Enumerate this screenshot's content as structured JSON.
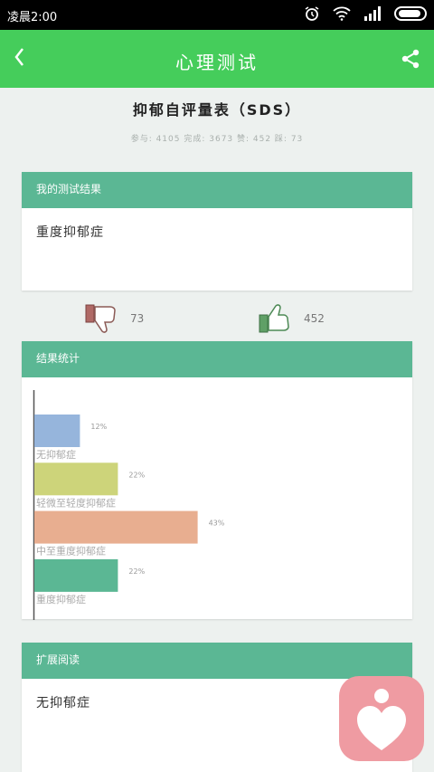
{
  "status_bar": {
    "time": "凌晨2:00"
  },
  "app_bar": {
    "title": "心理测试",
    "back_icon": "chevron-left-icon",
    "share_icon": "share-icon",
    "background": "#45cd5b"
  },
  "test": {
    "title": "抑郁自评量表（SDS）",
    "stats_line": "参与: 4105 完成: 3673 赞: 452 踩: 73"
  },
  "result_card": {
    "header": "我的测试结果",
    "result": "重度抑郁症"
  },
  "votes": {
    "dislike_count": "73",
    "like_count": "452"
  },
  "stats_card": {
    "header": "结果统计"
  },
  "chart_data": {
    "type": "bar",
    "orientation": "horizontal",
    "categories": [
      "无抑郁症",
      "轻微至轻度抑郁症",
      "中至重度抑郁症",
      "重度抑郁症"
    ],
    "values": [
      12,
      22,
      43,
      22
    ],
    "value_labels": [
      "12%",
      "22%",
      "43%",
      "22%"
    ],
    "colors": [
      "#96b5dc",
      "#cdd47a",
      "#e8ae90",
      "#5bb794"
    ],
    "xlim": [
      0,
      100
    ],
    "grid": false
  },
  "reading_card": {
    "header": "扩展阅读",
    "content": "无抑郁症"
  },
  "colors": {
    "header_green": "#5bb794",
    "fab_pink": "#ef9ba2"
  }
}
